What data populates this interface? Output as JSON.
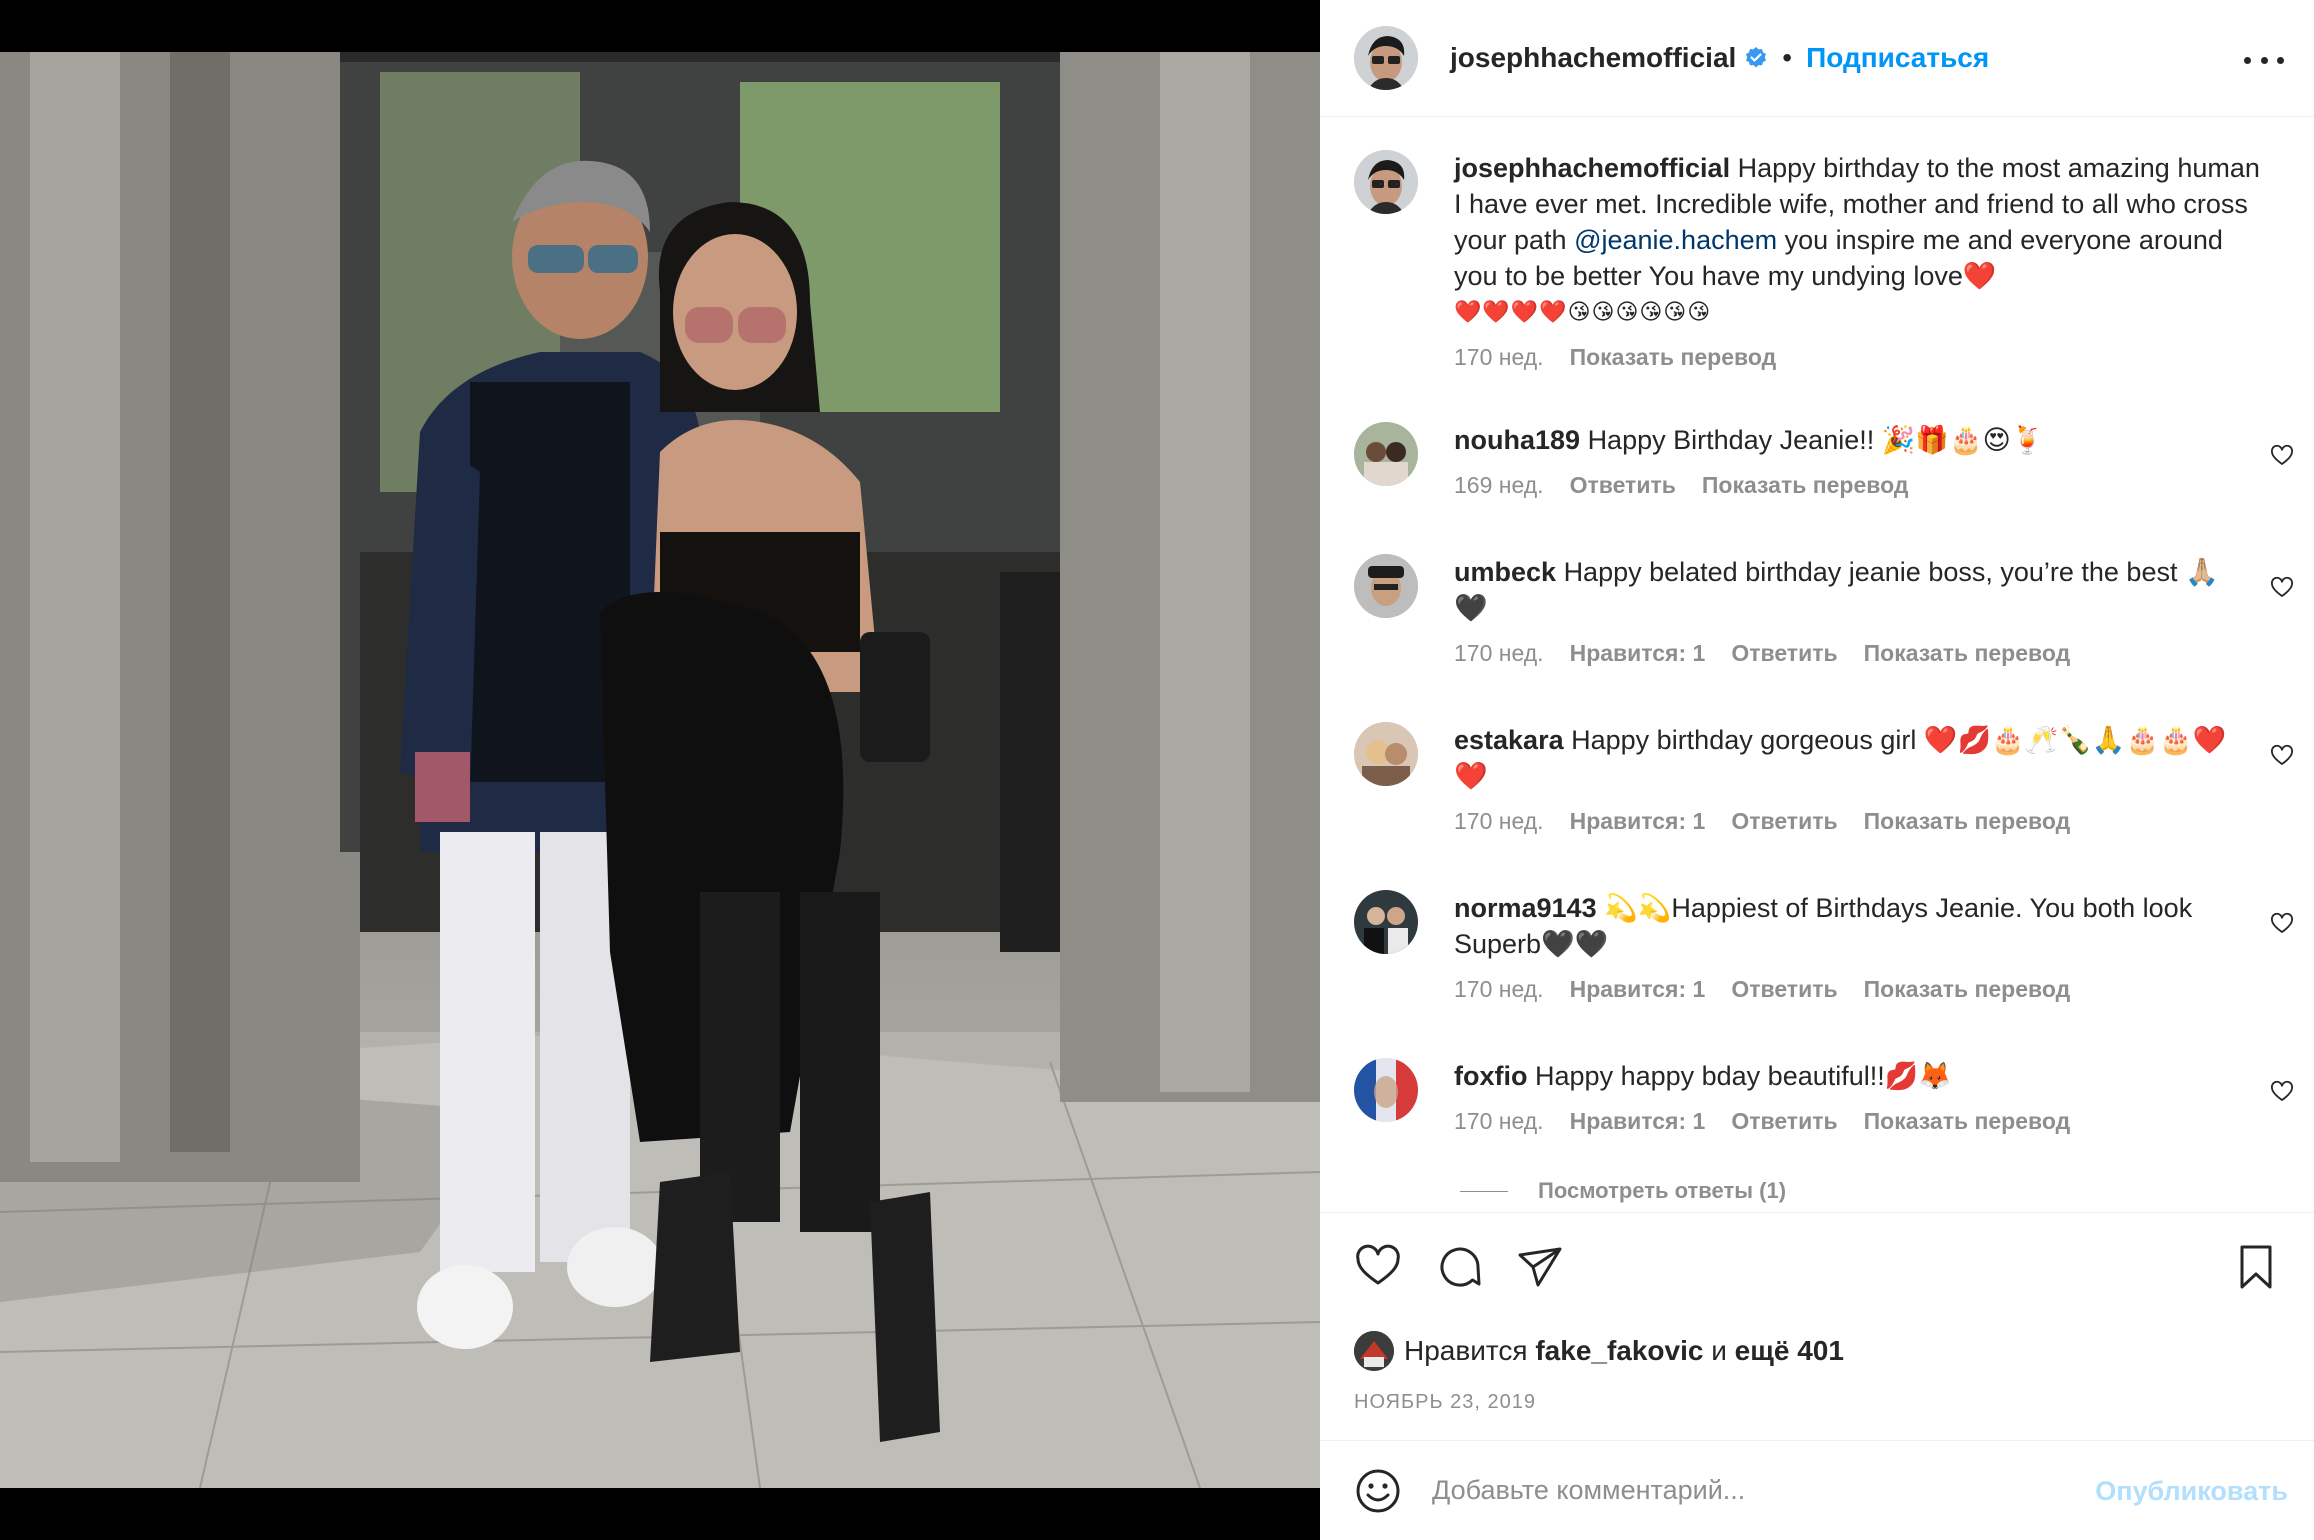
{
  "post": {
    "username": "josephhachemofficial",
    "separator": "•",
    "follow_label": "Подписаться",
    "more_icon": "more-horizontal-icon"
  },
  "caption": {
    "username": "josephhachemofficial",
    "text_before": "Happy birthday to the most amazing human I have ever met. Incredible wife, mother and friend to all who cross your path ",
    "mention": "@jeanie.hachem",
    "text_after": " you inspire me and everyone around you to be better You have my undying love❤️",
    "emoji_row": "❤️❤️❤️❤️😘😘😘😘😘😘",
    "time": "170 нед.",
    "translate": "Показать перевод"
  },
  "comments": [
    {
      "username": "nouha189",
      "text": "Happy Birthday Jeanie!! 🎉🎁🎂😍🍹",
      "time": "169 нед.",
      "likes": "",
      "reply": "Ответить",
      "translate": "Показать перевод"
    },
    {
      "username": "umbeck",
      "text": "Happy belated birthday jeanie boss, you’re the best 🙏🏼🖤",
      "time": "170 нед.",
      "likes": "Нравится: 1",
      "reply": "Ответить",
      "translate": "Показать перевод"
    },
    {
      "username": "estakara",
      "text": "Happy birthday gorgeous girl ❤️💋🎂🥂🍾🙏🎂🎂❤️❤️",
      "time": "170 нед.",
      "likes": "Нравится: 1",
      "reply": "Ответить",
      "translate": "Показать перевод"
    },
    {
      "username": "norma9143",
      "text": "💫💫Happiest of Birthdays Jeanie. You both look Superb🖤🖤",
      "time": "170 нед.",
      "likes": "Нравится: 1",
      "reply": "Ответить",
      "translate": "Показать перевод"
    },
    {
      "username": "foxfio",
      "text": "Happy happy bday beautiful!!💋🦊",
      "time": "170 нед.",
      "likes": "Нравится: 1",
      "reply": "Ответить",
      "translate": "Показать перевод"
    }
  ],
  "view_replies": "Посмотреть ответы (1)",
  "likes": {
    "prefix": "Нравится",
    "user": "fake_fakovic",
    "joiner": "и",
    "others": "ещё 401"
  },
  "date": "НОЯБРЬ 23, 2019",
  "add_comment": {
    "placeholder": "Добавьте комментарий...",
    "publish": "Опубликовать"
  },
  "colors": {
    "accent": "#0095f6",
    "publish_disabled": "#b2dffc",
    "muted": "#8e8e8e",
    "text": "#262626",
    "mention": "#00376b"
  }
}
